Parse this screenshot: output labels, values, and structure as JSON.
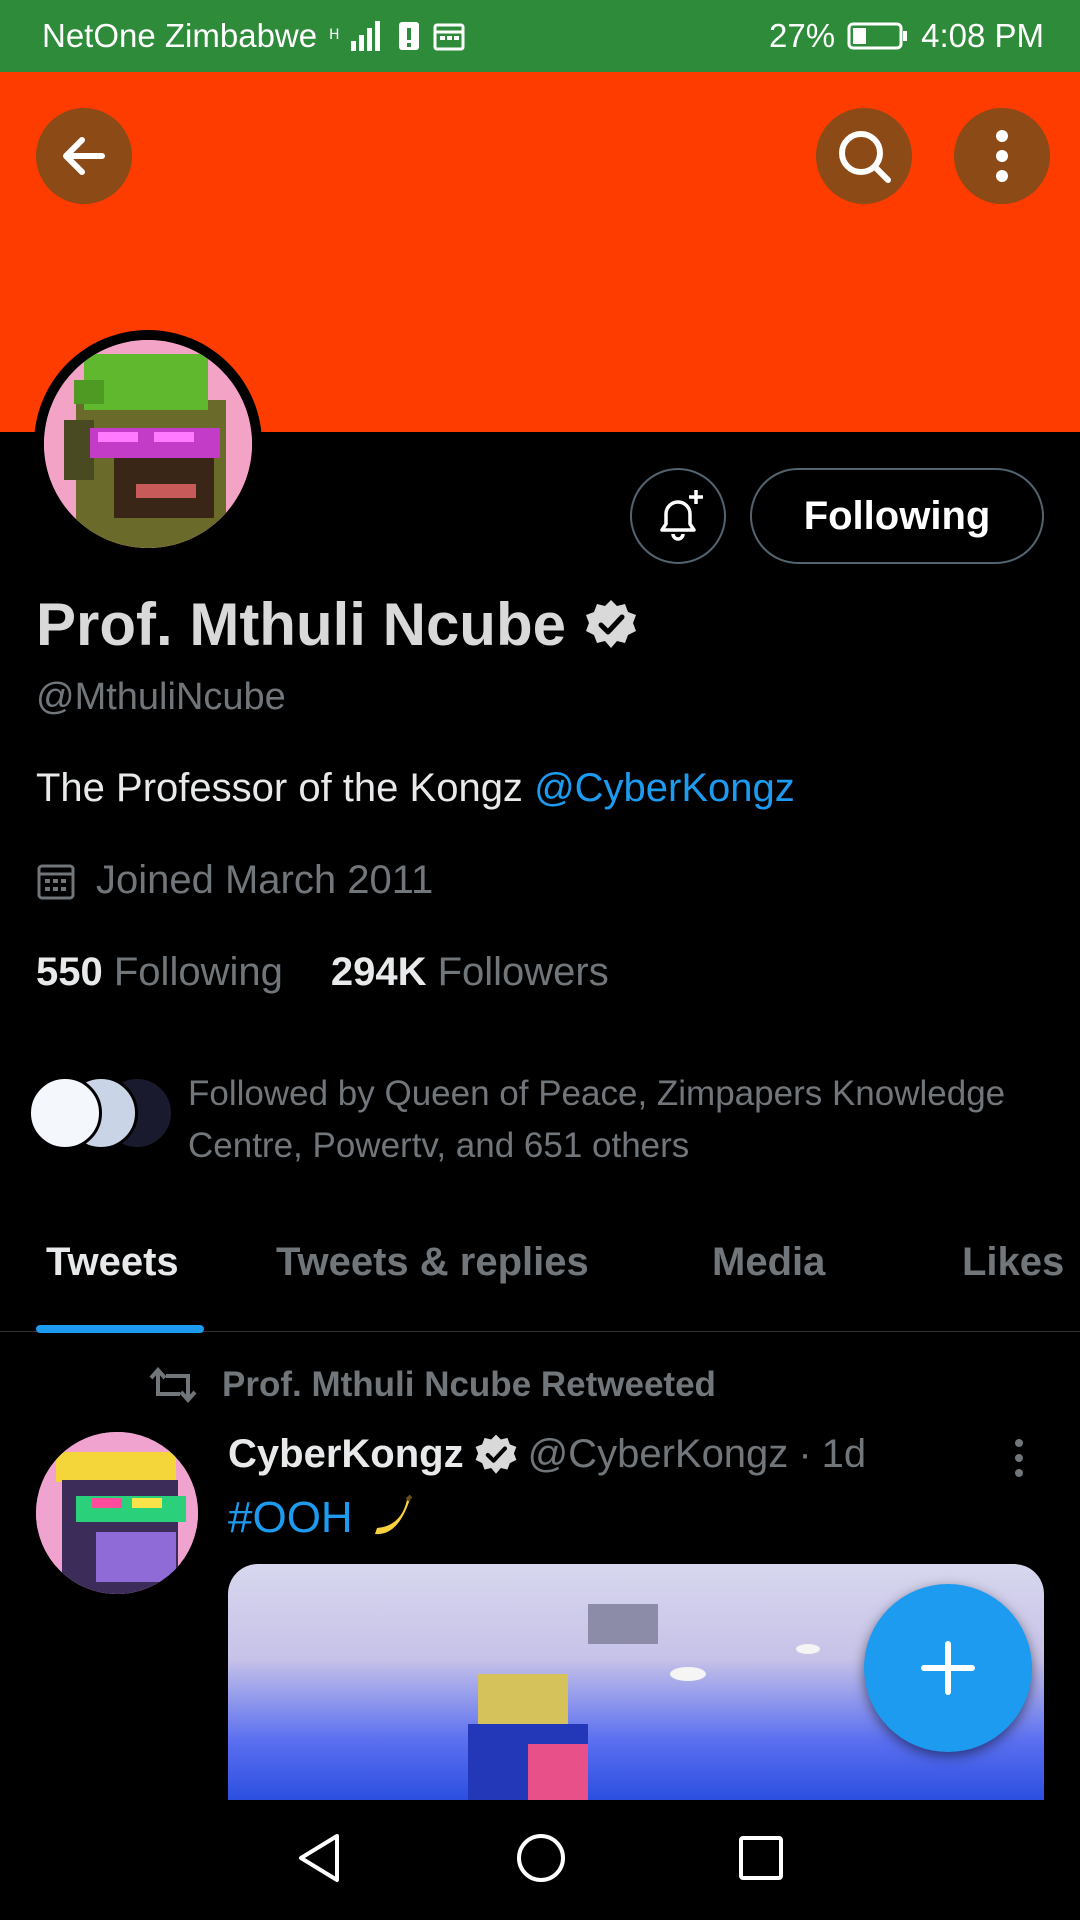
{
  "status_bar": {
    "carrier": "NetOne Zimbabwe",
    "battery_percent": "27%",
    "time": "4:08 PM"
  },
  "profile": {
    "name": "Prof. Mthuli Ncube",
    "handle": "@MthuliNcube",
    "bio_text": "The Professor of the Kongz",
    "bio_mention": "@CyberKongz",
    "joined": "Joined March 2011",
    "following_count": "550",
    "following_label": "Following",
    "followers_count": "294K",
    "followers_label": "Followers",
    "follow_button": "Following",
    "followed_by": "Followed by Queen of Peace, Zimpapers Knowledge Centre, Powertv, and 651 others"
  },
  "tabs": [
    {
      "label": "Tweets"
    },
    {
      "label": "Tweets & replies"
    },
    {
      "label": "Media"
    },
    {
      "label": "Likes"
    }
  ],
  "tweet": {
    "retweet_label": "Prof. Mthuli Ncube Retweeted",
    "author_name": "CyberKongz",
    "author_handle": "@CyberKongz",
    "separator": "·",
    "age": "1d",
    "hashtag": "#OOH"
  },
  "colors": {
    "status_bar": "#2e8b3a",
    "banner": "#ff3c00",
    "accent": "#1d9bf0",
    "round_button": "#8b4a16"
  },
  "icons": {
    "back": "arrow-left-icon",
    "search": "search-icon",
    "more": "more-vertical-icon",
    "notify": "bell-plus-icon",
    "verified": "verified-badge-icon",
    "calendar": "calendar-icon",
    "retweet": "retweet-icon",
    "compose": "plus-icon"
  }
}
